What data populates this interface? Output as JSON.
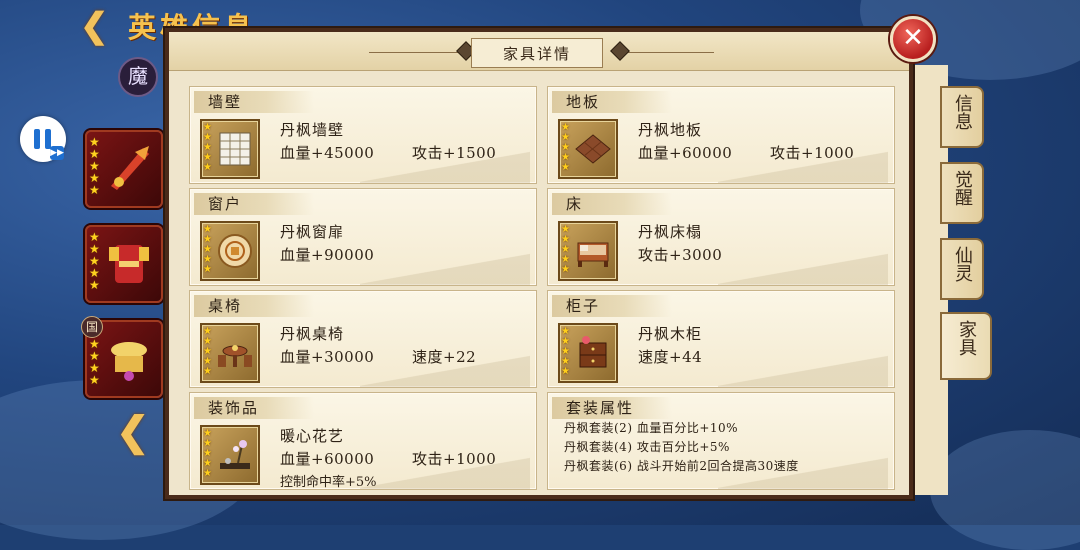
{
  "background": {
    "hero_title": "英雄信息",
    "pause_fastforward_icon": "▶▶",
    "faction_badge": "魔",
    "equip_tag": "国"
  },
  "modal": {
    "title": "家具详情",
    "close_icon": "✕"
  },
  "side_tabs": [
    {
      "label": "信息",
      "active": false
    },
    {
      "label": "觉醒",
      "active": false
    },
    {
      "label": "仙灵",
      "active": false
    },
    {
      "label": "家具",
      "active": true
    }
  ],
  "items": [
    {
      "category": "墙壁",
      "name": "丹枫墙壁",
      "stat1": "血量+45000",
      "stat2": "攻击+1500",
      "extra": "",
      "icon": "wall-icon"
    },
    {
      "category": "地板",
      "name": "丹枫地板",
      "stat1": "血量+60000",
      "stat2": "攻击+1000",
      "extra": "",
      "icon": "floor-icon"
    },
    {
      "category": "窗户",
      "name": "丹枫窗扉",
      "stat1": "血量+90000",
      "stat2": "",
      "extra": "",
      "icon": "window-icon"
    },
    {
      "category": "床",
      "name": "丹枫床榻",
      "stat1": "攻击+3000",
      "stat2": "",
      "extra": "",
      "icon": "bed-icon"
    },
    {
      "category": "桌椅",
      "name": "丹枫桌椅",
      "stat1": "血量+30000",
      "stat2": "速度+22",
      "extra": "",
      "icon": "table-chair-icon"
    },
    {
      "category": "柜子",
      "name": "丹枫木柜",
      "stat1": "速度+44",
      "stat2": "",
      "extra": "",
      "icon": "cabinet-icon"
    },
    {
      "category": "装饰品",
      "name": "暖心花艺",
      "stat1": "血量+60000",
      "stat2": "攻击+1000",
      "extra": "控制命中率+5%",
      "icon": "flower-decor-icon"
    }
  ],
  "set_bonus": {
    "title": "套装属性",
    "lines": [
      "丹枫套装(2) 血量百分比+10%",
      "丹枫套装(4) 攻击百分比+5%",
      "丹枫套装(6) 战斗开始前2回合提高30速度"
    ]
  },
  "colors": {
    "background": "#21457e",
    "panel": "#efe5cc",
    "accent_gold": "#f2c25c",
    "close_red": "#b81f1f",
    "star": "#ffcf1a"
  }
}
